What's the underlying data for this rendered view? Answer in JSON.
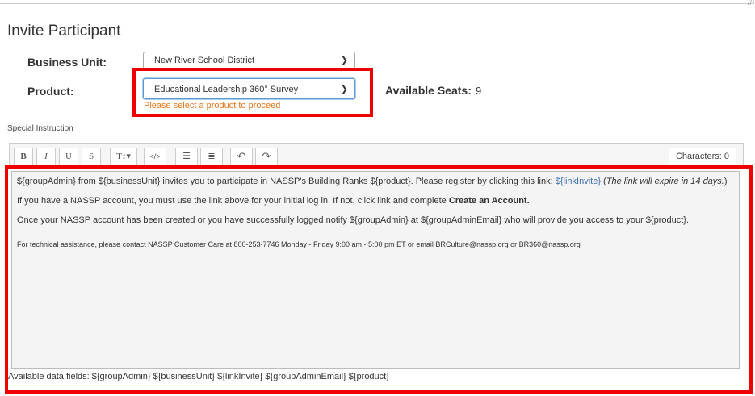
{
  "title": "Invite Participant",
  "business_unit": {
    "label": "Business Unit:",
    "value": "New River School District"
  },
  "product": {
    "label": "Product:",
    "value": "Educational Leadership 360° Survey",
    "error": "Please select a product to proceed"
  },
  "seats": {
    "label": "Available Seats:",
    "value": "9"
  },
  "special_instruction_label": "Special Instruction",
  "toolbar": {
    "bold": "B",
    "italic": "I",
    "underline": "U",
    "strike": "S",
    "text_size": "T↕▾",
    "code": "</>",
    "bullets": "☰",
    "numbers": "≣",
    "undo": "↶",
    "redo": "↷",
    "characters": "Characters:  0"
  },
  "editor": {
    "p1_a": "${groupAdmin} from ${businessUnit} invites you to participate in NASSP's Building Ranks ${product}. Please register by clicking this link: ",
    "p1_link": "${linkInvite}",
    "p1_b": " (",
    "p1_italic": "The link will expire in 14 days.",
    "p1_c": ")",
    "p2_a": "If you have a NASSP account, you must use the link above for your initial log in. If not, click link and complete ",
    "p2_bold": "Create an Account.",
    "p3": "Once your NASSP account has been created or you have successfully logged notify ${groupAdmin} at ${groupAdminEmail} who will provide you access to your ${product}.",
    "p4": "For technical assistance, please contact NASSP Customer Care at 800-253-7746 Monday - Friday 9:00 am - 5:00 pm ET or email BRCulture@nassp.org or BR360@nassp.org"
  },
  "available_fields": "Available data fields: ${groupAdmin} ${businessUnit} ${linkInvite} ${groupAdminEmail} ${product}"
}
